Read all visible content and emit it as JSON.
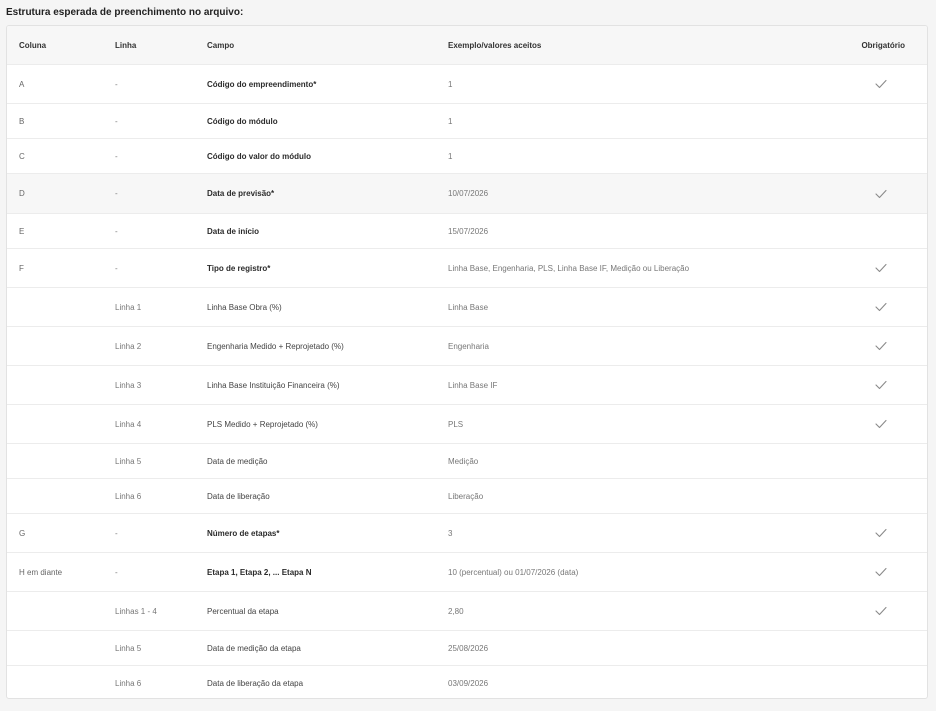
{
  "section_title": "Estrutura esperada de preenchimento no arquivo:",
  "headers": {
    "coluna": "Coluna",
    "linha": "Linha",
    "campo": "Campo",
    "exemplo": "Exemplo/valores aceitos",
    "obrigatorio": "Obrigatório"
  },
  "rows": [
    {
      "coluna": "A",
      "linha": "-",
      "campo": "Código do empreendimento*",
      "exemplo": "1",
      "obrigatorio": true,
      "bold": true
    },
    {
      "coluna": "B",
      "linha": "-",
      "campo": "Código do módulo",
      "exemplo": "1",
      "obrigatorio": false,
      "bold": true
    },
    {
      "coluna": "C",
      "linha": "-",
      "campo": "Código do valor do módulo",
      "exemplo": "1",
      "obrigatorio": false,
      "bold": true
    },
    {
      "coluna": "D",
      "linha": "-",
      "campo": "Data de previsão*",
      "exemplo": "10/07/2026",
      "obrigatorio": true,
      "bold": true
    },
    {
      "coluna": "E",
      "linha": "-",
      "campo": "Data de início",
      "exemplo": "15/07/2026",
      "obrigatorio": false,
      "bold": true
    },
    {
      "coluna": "F",
      "linha": "-",
      "campo": "Tipo de registro*",
      "exemplo": "Linha Base, Engenharia, PLS, Linha Base IF, Medição ou Liberação",
      "obrigatorio": true,
      "bold": true
    },
    {
      "coluna": "",
      "linha": "Linha 1",
      "campo": "Linha Base Obra (%)",
      "exemplo": "Linha Base",
      "obrigatorio": true,
      "bold": false
    },
    {
      "coluna": "",
      "linha": "Linha 2",
      "campo": "Engenharia Medido + Reprojetado (%)",
      "exemplo": "Engenharia",
      "obrigatorio": true,
      "bold": false
    },
    {
      "coluna": "",
      "linha": "Linha 3",
      "campo": "Linha Base Instituição Financeira (%)",
      "exemplo": "Linha Base IF",
      "obrigatorio": true,
      "bold": false
    },
    {
      "coluna": "",
      "linha": "Linha 4",
      "campo": "PLS Medido + Reprojetado (%)",
      "exemplo": "PLS",
      "obrigatorio": true,
      "bold": false
    },
    {
      "coluna": "",
      "linha": "Linha 5",
      "campo": "Data de medição",
      "exemplo": "Medição",
      "obrigatorio": false,
      "bold": false
    },
    {
      "coluna": "",
      "linha": "Linha 6",
      "campo": "Data de liberação",
      "exemplo": "Liberação",
      "obrigatorio": false,
      "bold": false
    },
    {
      "coluna": "G",
      "linha": "-",
      "campo": "Número de etapas*",
      "exemplo": "3",
      "obrigatorio": true,
      "bold": true
    },
    {
      "coluna": "H em diante",
      "linha": "-",
      "campo": "Etapa 1, Etapa 2, ... Etapa N",
      "exemplo": "10 (percentual) ou 01/07/2026 (data)",
      "obrigatorio": true,
      "bold": true
    },
    {
      "coluna": "",
      "linha": "Linhas 1 - 4",
      "campo": "Percentual da etapa",
      "exemplo": "2,80",
      "obrigatorio": true,
      "bold": false
    },
    {
      "coluna": "",
      "linha": "Linha 5",
      "campo": "Data de medição da etapa",
      "exemplo": "25/08/2026",
      "obrigatorio": false,
      "bold": false
    },
    {
      "coluna": "",
      "linha": "Linha 6",
      "campo": "Data de liberação da etapa",
      "exemplo": "03/09/2026",
      "obrigatorio": false,
      "bold": false
    }
  ],
  "colors": {
    "check": "#8a8a8a",
    "header_bg": "#f7f7f7"
  },
  "icons": {
    "required": "check-icon"
  }
}
